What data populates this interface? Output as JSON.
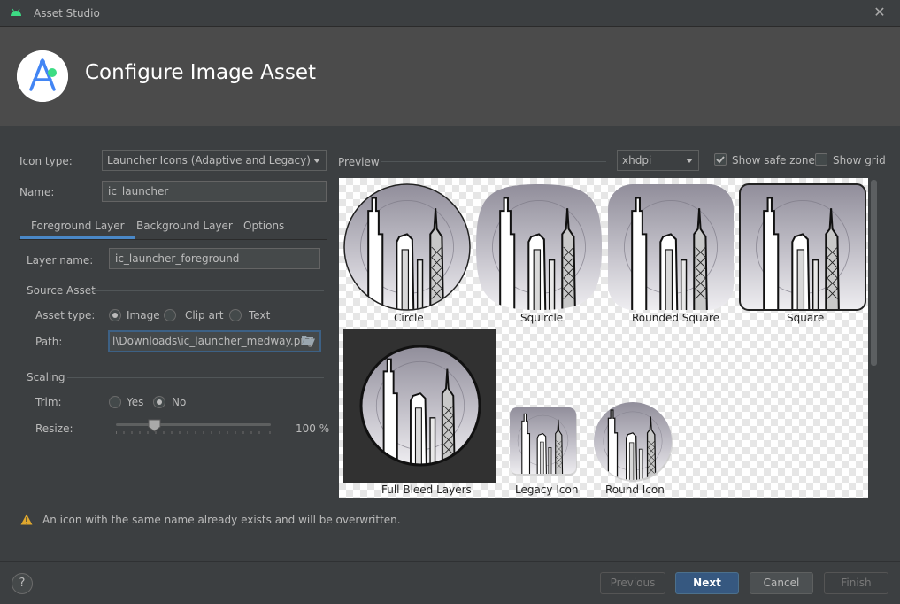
{
  "window": {
    "title": "Asset Studio"
  },
  "header": {
    "title": "Configure Image Asset"
  },
  "form": {
    "icon_type_label": "Icon type:",
    "icon_type_value": "Launcher Icons (Adaptive and Legacy)",
    "name_label": "Name:",
    "name_value": "ic_launcher",
    "tabs": [
      {
        "label": "Foreground Layer",
        "active": true
      },
      {
        "label": "Background Layer",
        "active": false
      },
      {
        "label": "Options",
        "active": false
      }
    ],
    "layer_name_label": "Layer name:",
    "layer_name_value": "ic_launcher_foreground",
    "source_asset_label": "Source Asset",
    "asset_type_label": "Asset type:",
    "asset_type_options": [
      {
        "label": "Image",
        "selected": true
      },
      {
        "label": "Clip art",
        "selected": false
      },
      {
        "label": "Text",
        "selected": false
      }
    ],
    "path_label": "Path:",
    "path_value": "l\\Downloads\\ic_launcher_medway.png",
    "scaling_label": "Scaling",
    "trim_label": "Trim:",
    "trim_options": [
      {
        "label": "Yes",
        "selected": false
      },
      {
        "label": "No",
        "selected": true
      }
    ],
    "resize_label": "Resize:",
    "resize_value": "100 %"
  },
  "preview": {
    "label": "Preview",
    "density_value": "xhdpi",
    "show_safe_zone_label": "Show safe zone",
    "show_safe_zone_checked": true,
    "show_grid_label": "Show grid",
    "show_grid_checked": false,
    "captions": {
      "circle": "Circle",
      "squircle": "Squircle",
      "rounded_square": "Rounded Square",
      "square": "Square",
      "full_bleed": "Full Bleed Layers",
      "legacy": "Legacy Icon",
      "round": "Round Icon"
    }
  },
  "warning": {
    "text": "An icon with the same name already exists and will be overwritten.",
    "color": "#e0a82e"
  },
  "footer": {
    "help_label": "?",
    "previous_label": "Previous",
    "next_label": "Next",
    "cancel_label": "Cancel",
    "finish_label": "Finish"
  },
  "colors": {
    "accent": "#4a88c7",
    "primary_button": "#365880"
  }
}
